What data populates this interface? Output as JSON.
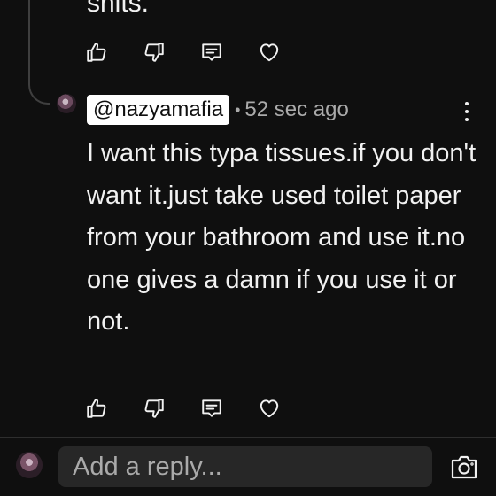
{
  "previous_comment": {
    "text_fragment": "shits."
  },
  "reply": {
    "handle": "@nazyamafia",
    "separator": "•",
    "time": "52 sec ago",
    "text": "I want this typa tissues.if you don't want it.just take used toilet paper from your bathroom and use it.no one gives a damn if you use it or not."
  },
  "actions": {
    "icons": [
      "thumbs-up-icon",
      "thumbs-down-icon",
      "reply-icon",
      "heart-icon"
    ]
  },
  "composer": {
    "placeholder": "Add a reply...",
    "camera_icon": "camera-icon"
  },
  "colors": {
    "background": "#0f0f0f",
    "text": "#f1f1f1",
    "secondary_text": "#aaaaaa",
    "input_bg": "#272727",
    "handle_highlight": "#ffffff"
  }
}
